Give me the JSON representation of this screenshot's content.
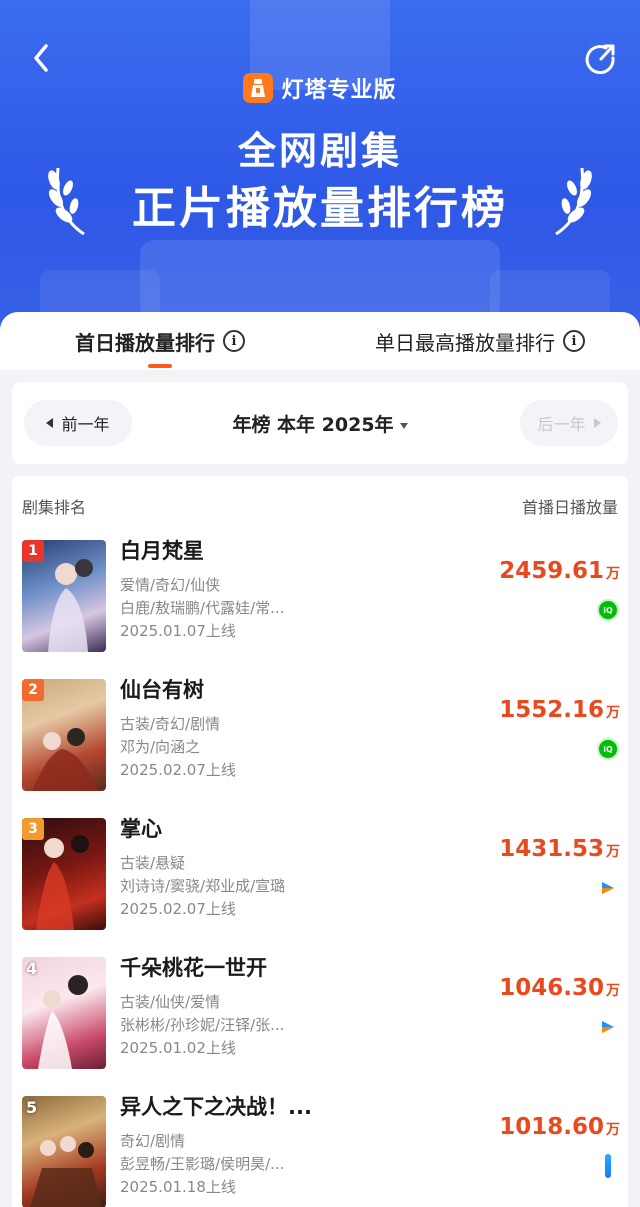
{
  "colors": {
    "accent": "#e8491e",
    "header_blue": "#2e58e6",
    "brand_orange": "#ff7a1a",
    "rank1": "#e8362a",
    "rank2": "#f26a2e",
    "rank3": "#f29a2e"
  },
  "header": {
    "brand_name": "灯塔专业版",
    "title_line1": "全网剧集",
    "title_line2": "正片播放量排行榜",
    "back_icon": "chevron-left-icon",
    "action_icon": "share-icon"
  },
  "tabs": [
    {
      "label": "首日播放量排行",
      "active": true
    },
    {
      "label": "单日最高播放量排行",
      "active": false
    }
  ],
  "year_selector": {
    "prev_label": "前一年",
    "center_label": "年榜 本年 2025年",
    "next_label": "后一年"
  },
  "list_header": {
    "left": "剧集排名",
    "right": "首播日播放量"
  },
  "items": [
    {
      "rank": "1",
      "title": "白月梵星",
      "genres": "爱情/奇幻/仙侠",
      "cast": "白鹿/敖瑞鹏/代露娃/常...",
      "date": "2025.01.07上线",
      "value": "2459.61",
      "unit": "万",
      "platform": "iqiyi",
      "platform_label": "爱奇艺"
    },
    {
      "rank": "2",
      "title": "仙台有树",
      "genres": "古装/奇幻/剧情",
      "cast": "邓为/向涵之",
      "date": "2025.02.07上线",
      "value": "1552.16",
      "unit": "万",
      "platform": "iqiyi",
      "platform_label": "爱奇艺"
    },
    {
      "rank": "3",
      "title": "掌心",
      "genres": "古装/悬疑",
      "cast": "刘诗诗/窦骁/郑业成/宣璐",
      "date": "2025.02.07上线",
      "value": "1431.53",
      "unit": "万",
      "platform": "youku",
      "platform_label": "优酷"
    },
    {
      "rank": "4",
      "title": "千朵桃花一世开",
      "genres": "古装/仙侠/爱情",
      "cast": "张彬彬/孙珍妮/汪铎/张...",
      "date": "2025.01.02上线",
      "value": "1046.30",
      "unit": "万",
      "platform": "youku",
      "platform_label": "优酷"
    },
    {
      "rank": "5",
      "title": "异人之下之决战！...",
      "genres": "奇幻/剧情",
      "cast": "彭昱畅/王影璐/侯明昊/...",
      "date": "2025.01.18上线",
      "value": "1018.60",
      "unit": "万",
      "platform": "youku",
      "platform_label": "优酷"
    }
  ]
}
